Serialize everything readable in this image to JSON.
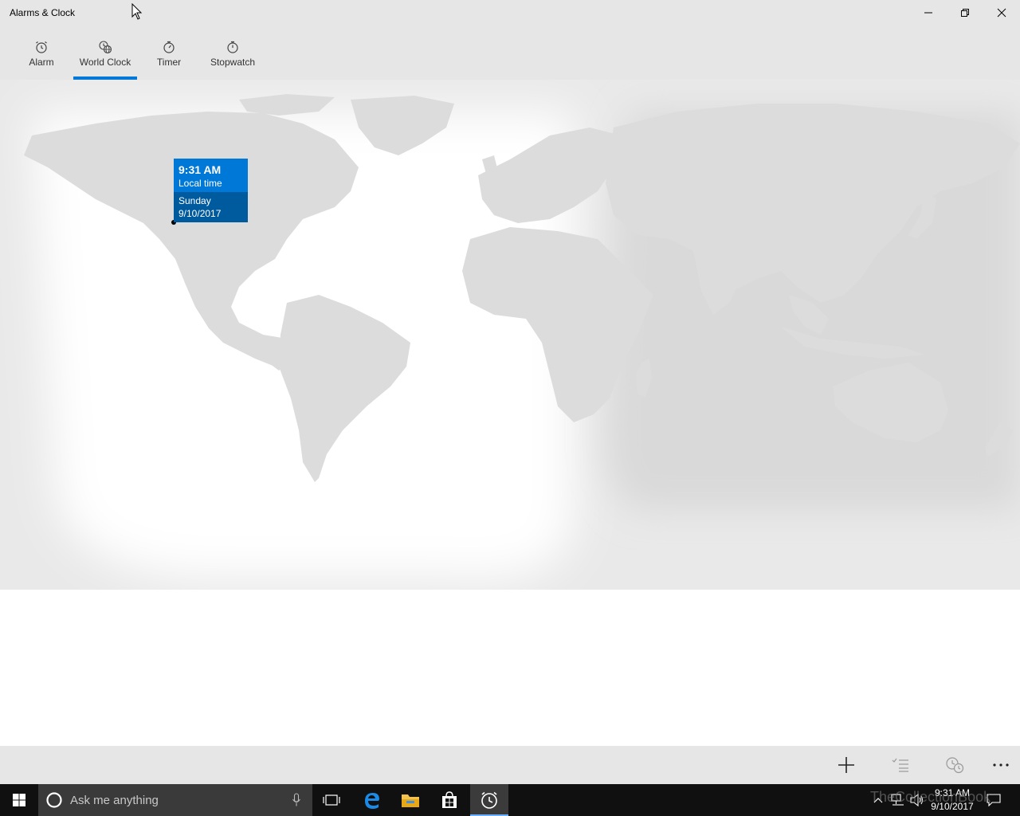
{
  "window": {
    "title": "Alarms & Clock"
  },
  "tabs": [
    {
      "label": "Alarm",
      "icon": "alarm-clock-icon"
    },
    {
      "label": "World Clock",
      "icon": "globe-clock-icon",
      "selected": true
    },
    {
      "label": "Timer",
      "icon": "timer-icon"
    },
    {
      "label": "Stopwatch",
      "icon": "stopwatch-icon"
    }
  ],
  "accent_color": "#0078d7",
  "map": {
    "local_card": {
      "time": "9:31 AM",
      "subtitle": "Local time",
      "day": "Sunday",
      "date": "9/10/2017"
    }
  },
  "command_bar": {
    "add_icon": "plus-icon",
    "edit_icon": "checklist-icon",
    "compare_icon": "compare-clock-icon",
    "more_icon": "more-icon"
  },
  "taskbar": {
    "search_placeholder": "Ask me anything",
    "tray_time": "9:31 AM",
    "tray_date": "9/10/2017",
    "watermark": "TheCollectionBook"
  }
}
